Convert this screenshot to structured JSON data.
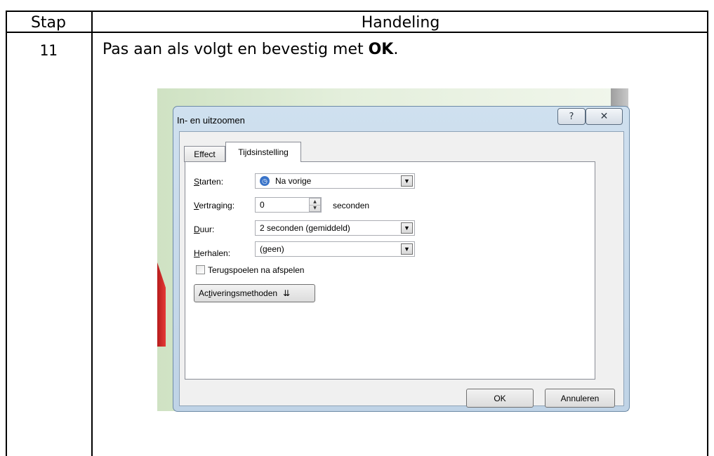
{
  "table": {
    "header_stap": "Stap",
    "header_handeling": "Handeling",
    "step_number": "11",
    "instruction_pre": "Pas aan als volgt en bevestig met ",
    "instruction_bold": "OK",
    "instruction_post": "."
  },
  "dialog": {
    "title": "In- en uitzoomen",
    "help_glyph": "?",
    "close_glyph": "✕",
    "tabs": [
      "Effect",
      "Tijdsinstelling"
    ],
    "active_tab": "Tijdsinstelling",
    "starten": {
      "label_u": "S",
      "label_rest": "tarten:",
      "value": "Na vorige"
    },
    "vertraging": {
      "label_u": "V",
      "label_rest": "ertraging:",
      "value": "0",
      "unit": "seconden"
    },
    "duur": {
      "label_u": "D",
      "label_rest": "uur:",
      "value": "2 seconden (gemiddeld)"
    },
    "herhalen": {
      "label_u": "H",
      "label_rest": "erhalen:",
      "value": "(geen)"
    },
    "terugspoelen": {
      "pre": "Teru",
      "u": "g",
      "post": "spoelen na afspelen",
      "checked": false
    },
    "activering": {
      "pre": "Ac",
      "u": "t",
      "post": "iveringsmethoden"
    },
    "ok_label": "OK",
    "cancel_label": "Annuleren"
  }
}
